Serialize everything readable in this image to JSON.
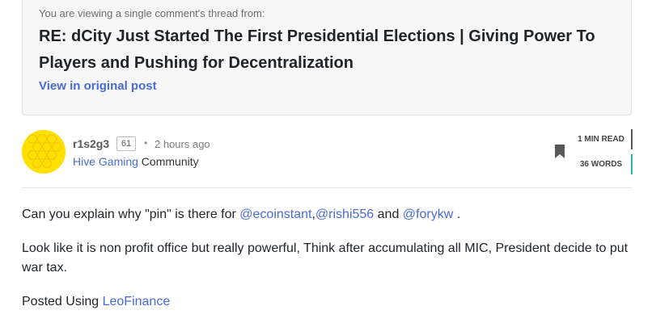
{
  "thread": {
    "note": "You are viewing a single comment's thread from:",
    "title": "RE: dCity Just Started The First Presidential Elections | Giving Power To Players and Pushing for Decentralization",
    "view_link": "View in original post"
  },
  "post": {
    "author": "r1s2g3",
    "reputation": "61",
    "separator": "•",
    "time": "2 hours ago",
    "community_name": "Hive Gaming",
    "community_suffix": " Community",
    "read_time": "1 MIN READ",
    "word_count": "36 WORDS"
  },
  "body": {
    "p1_prefix": "Can you explain why \"pin\" is there for ",
    "mention1": "@ecoinstant",
    "comma": ",",
    "mention2": "@rishi556",
    "and_text": " and ",
    "mention3": "@forykw",
    "p1_end": " .",
    "p2": "Look like it is non profit office but really powerful, Think after accumulating all MIC, President decide to put war tax.",
    "p3_prefix": "Posted Using ",
    "p3_link": "LeoFinance"
  },
  "colors": {
    "link": "#4a6bd6",
    "avatar": "#ffe000",
    "words_accent": "#2ab7b2"
  },
  "icons": {
    "bookmark": "bookmark-icon"
  }
}
